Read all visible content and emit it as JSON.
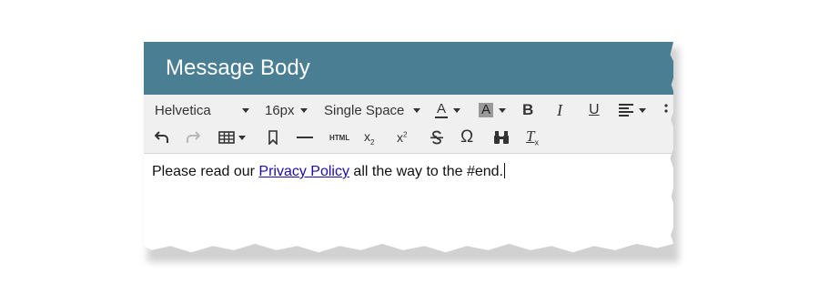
{
  "header": {
    "title": "Message Body"
  },
  "toolbar": {
    "font_family": "Helvetica",
    "font_size": "16px",
    "line_spacing": "Single Space",
    "icons": [
      "text-color-icon",
      "background-color-icon",
      "bold-icon",
      "italic-icon",
      "underline-icon",
      "align-icon",
      "undo-icon",
      "redo-icon",
      "table-icon",
      "bookmark-icon",
      "horizontal-rule-icon",
      "html-icon",
      "subscript-icon",
      "superscript-icon",
      "strikethrough-icon",
      "special-character-icon",
      "find-icon",
      "clear-format-icon"
    ],
    "labels": {
      "text_color": "A",
      "bg_color": "A",
      "bold": "B",
      "italic": "I",
      "underline": "U",
      "html": "HTML",
      "omega": "Ω"
    }
  },
  "editor": {
    "before_link": "Please read our ",
    "link_text": "Privacy Policy",
    "after_link": " all the way to the #end."
  },
  "colors": {
    "header": "#4a7f93",
    "toolbar": "#f0f0f0",
    "link": "#1a0dab"
  }
}
